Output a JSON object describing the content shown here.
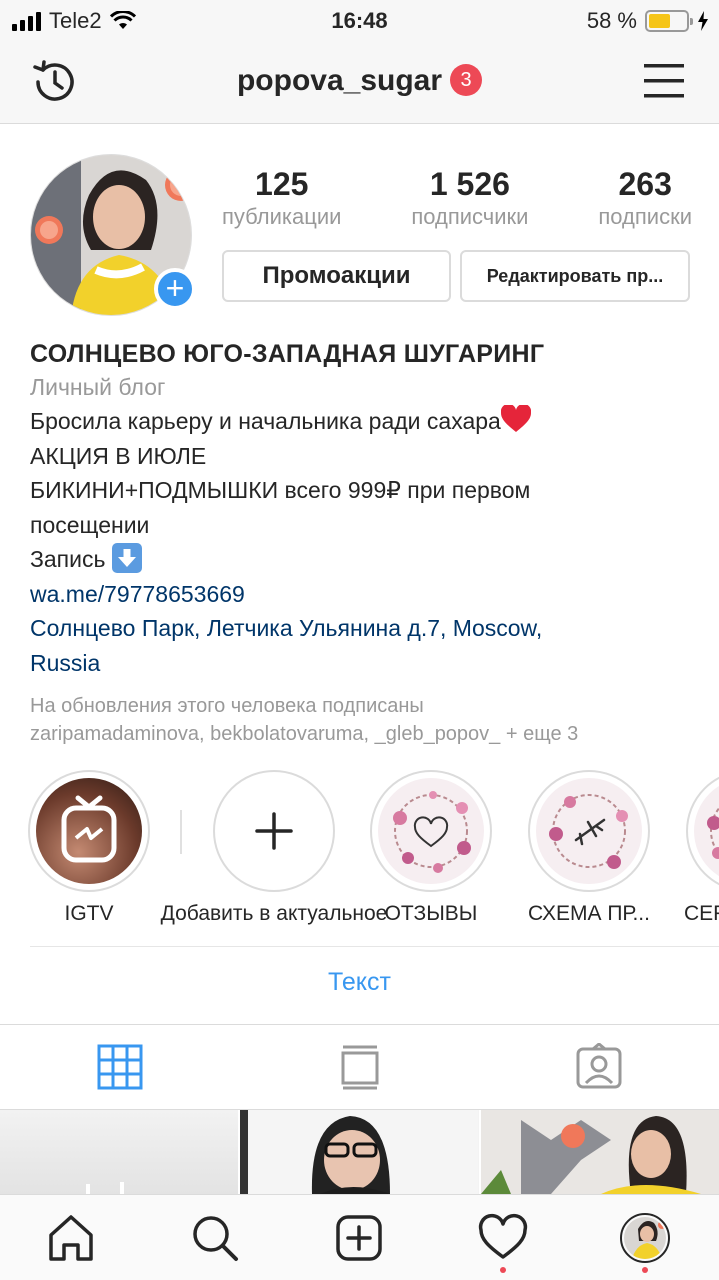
{
  "status_bar": {
    "carrier": "Tele2",
    "time": "16:48",
    "battery": "58 %",
    "battery_level": 0.58
  },
  "header": {
    "username": "popova_sugar",
    "notification_count": "3"
  },
  "profile": {
    "stats": [
      {
        "value": "125",
        "label": "публикации"
      },
      {
        "value": "1 526",
        "label": "подписчики"
      },
      {
        "value": "263",
        "label": "подписки"
      }
    ],
    "promo_button": "Промоакции",
    "edit_button": "Редактировать пр...",
    "name": "СОЛНЦЕВО ЮГО-ЗАПАДНАЯ ШУГАРИНГ",
    "category": "Личный блог",
    "bio_lines": [
      "Бросила карьеру и начальника ради сахара",
      "АКЦИЯ В ИЮЛЕ",
      "БИКИНИ+ПОДМЫШКИ всего 999₽ при первом",
      "посещении",
      "Запись"
    ],
    "website": "wa.me/79778653669",
    "address_lines": [
      "Солнцево Парк, Летчика Ульянина д.7, Moscow,",
      "Russia"
    ],
    "followed_by": [
      "На обновления этого человека подписаны",
      "zaripamadaminova, bekbolatovaruma, _gleb_popov_ + еще 3"
    ]
  },
  "highlights": [
    {
      "label": "IGTV",
      "icon": "igtv-icon"
    },
    {
      "label": "Добавить в актуальное",
      "icon": "plus-icon"
    },
    {
      "label": "ОТЗЫВЫ",
      "icon": "heart-wreath-icon"
    },
    {
      "label": "СХЕМА ПР...",
      "icon": "airplane-wreath-icon"
    },
    {
      "label": "СЕР",
      "icon": "wreath-icon"
    }
  ],
  "text_link": "Текст",
  "tabs": [
    "grid-icon",
    "feed-icon",
    "tagged-icon"
  ],
  "bottom_nav": [
    "home-icon",
    "search-icon",
    "new-post-icon",
    "activity-icon",
    "profile-avatar"
  ],
  "colors": {
    "accent": "#3897f0",
    "link": "#003569",
    "badge": "#ed4956",
    "battery": "#f5c518"
  }
}
